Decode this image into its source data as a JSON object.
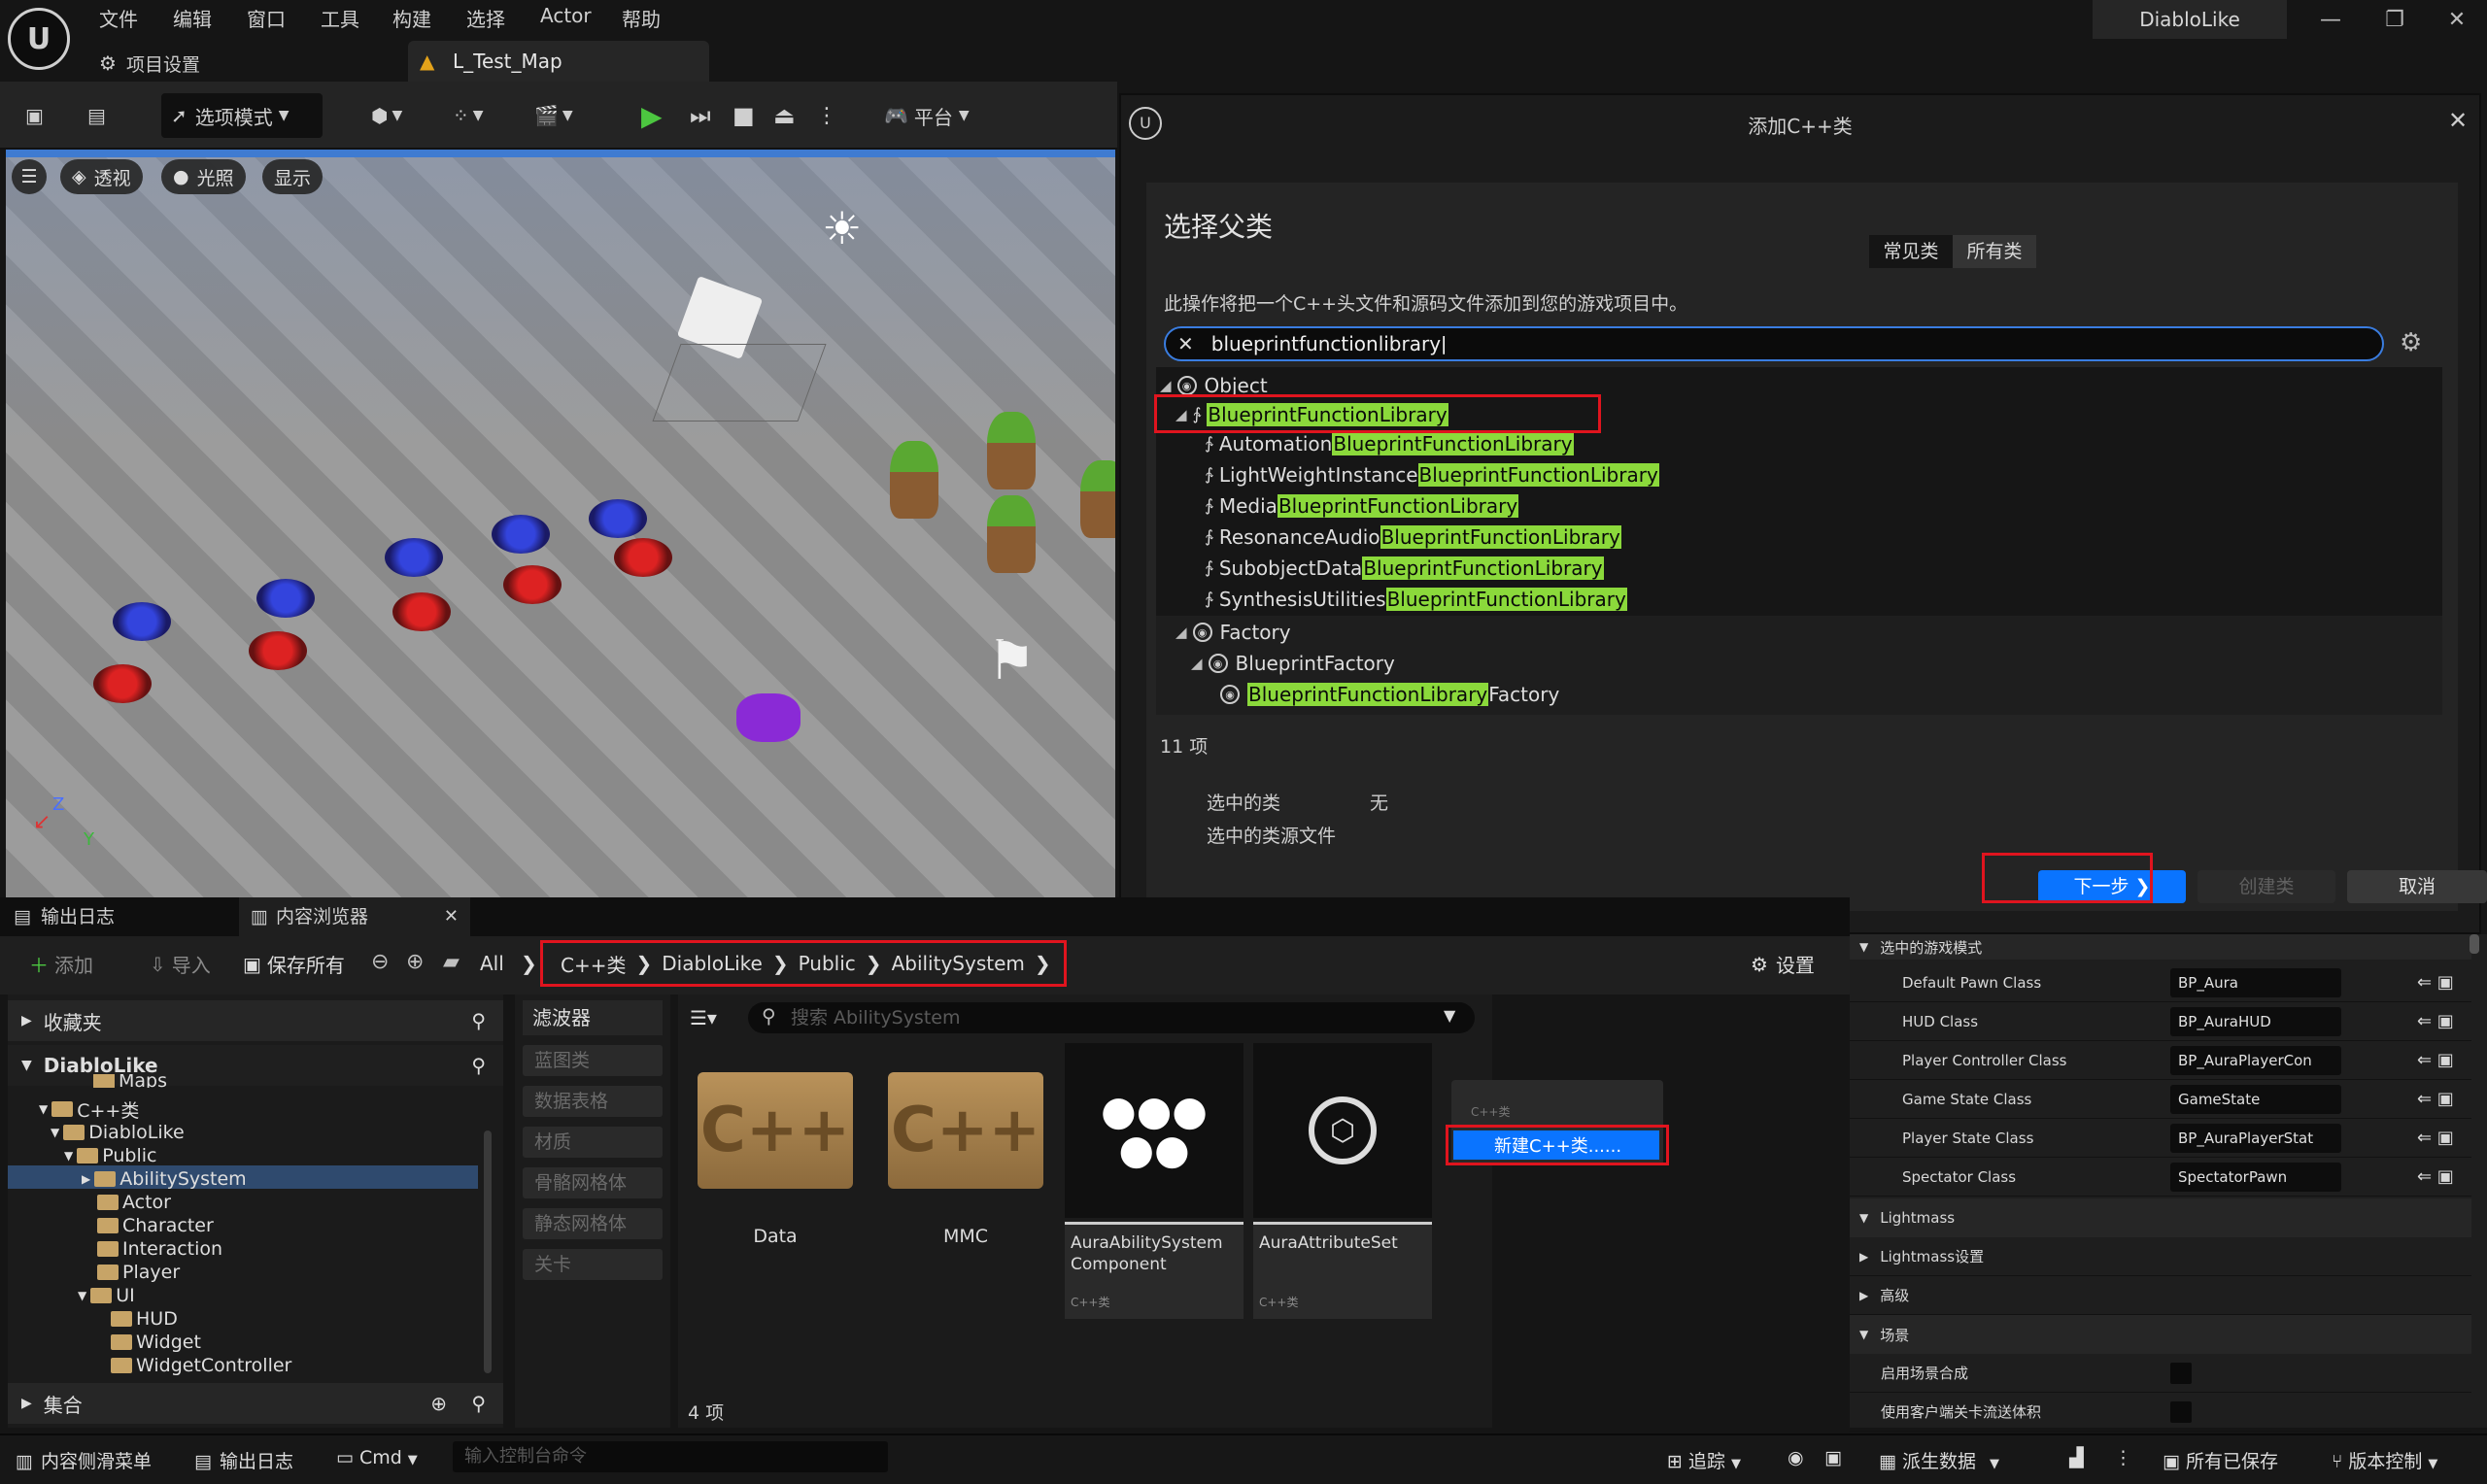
{
  "menu": {
    "items": [
      "文件",
      "编辑",
      "窗口",
      "工具",
      "构建",
      "选择",
      "Actor",
      "帮助"
    ]
  },
  "project_settings_tab": "项目设置",
  "map_tab": "L_Test_Map",
  "app_title": "DiabloLike",
  "toolbar": {
    "mode_label": "选项模式",
    "platform_label": "平台"
  },
  "viewport": {
    "perspective": "透视",
    "lighting": "光照",
    "show": "显示",
    "axis_z": "Z",
    "axis_y": "Y"
  },
  "dialog": {
    "title": "添加C++类",
    "heading": "选择父类",
    "tab_common": "常见类",
    "tab_all": "所有类",
    "description": "此操作将把一个C++头文件和源码文件添加到您的游戏项目中。",
    "search_value": "blueprintfunctionlibrary",
    "tree": {
      "object": "Object",
      "bfl": "BlueprintFunctionLibrary",
      "children": [
        {
          "prefix": "Automation",
          "match": "BlueprintFunctionLibrary"
        },
        {
          "prefix": "LightWeightInstance",
          "match": "BlueprintFunctionLibrary"
        },
        {
          "prefix": "Media",
          "match": "BlueprintFunctionLibrary"
        },
        {
          "prefix": "ResonanceAudio",
          "match": "BlueprintFunctionLibrary"
        },
        {
          "prefix": "SubobjectData",
          "match": "BlueprintFunctionLibrary"
        },
        {
          "prefix": "SynthesisUtilities",
          "match": "BlueprintFunctionLibrary"
        }
      ],
      "factory": "Factory",
      "blueprint_factory": "BlueprintFactory",
      "bfl_factory_match": "BlueprintFunctionLibrary",
      "bfl_factory_suffix": "Factory"
    },
    "item_count": "11 项",
    "selected_class_label": "选中的类",
    "selected_class_value": "无",
    "selected_source_label": "选中的类源文件",
    "btn_next": "下一步",
    "btn_create": "创建类",
    "btn_cancel": "取消"
  },
  "bottom_tabs": {
    "output_log": "输出日志",
    "content_browser": "内容浏览器"
  },
  "content_browser": {
    "add": "添加",
    "import": "导入",
    "save_all": "保存所有",
    "all": "All",
    "breadcrumb": [
      "C++类",
      "DiabloLike",
      "Public",
      "AbilitySystem"
    ],
    "settings": "设置",
    "favorites": "收藏夹",
    "project": "DiabloLike",
    "collections": "集合",
    "folders": [
      {
        "name": "Maps",
        "indent": 3
      },
      {
        "name": "C++类",
        "indent": 1
      },
      {
        "name": "DiabloLike",
        "indent": 2
      },
      {
        "name": "Public",
        "indent": 3
      },
      {
        "name": "AbilitySystem",
        "indent": 4
      },
      {
        "name": "Actor",
        "indent": 4
      },
      {
        "name": "Character",
        "indent": 4
      },
      {
        "name": "Interaction",
        "indent": 4
      },
      {
        "name": "Player",
        "indent": 4
      },
      {
        "name": "UI",
        "indent": 3
      },
      {
        "name": "HUD",
        "indent": 4
      },
      {
        "name": "Widget",
        "indent": 4
      },
      {
        "name": "WidgetController",
        "indent": 4
      }
    ],
    "filters_label": "滤波器",
    "filters": [
      "蓝图类",
      "数据表格",
      "材质",
      "骨骼网格体",
      "静态网格体",
      "关卡"
    ],
    "search_placeholder": "搜索 AbilitySystem",
    "assets": [
      {
        "name": "Data",
        "kind": "folder"
      },
      {
        "name": "MMC",
        "kind": "folder"
      },
      {
        "name": "AuraAbilitySystem Component",
        "type": "C++类"
      },
      {
        "name": "AuraAttributeSet",
        "type": "C++类"
      }
    ],
    "new_cpp_label": "新建C++类......",
    "new_cpp_header": "C++类",
    "item_count": "4 项"
  },
  "details": {
    "section_gamemode": "选中的游戏模式",
    "rows": [
      {
        "label": "Default Pawn Class",
        "value": "BP_Aura"
      },
      {
        "label": "HUD Class",
        "value": "BP_AuraHUD"
      },
      {
        "label": "Player Controller Class",
        "value": "BP_AuraPlayerCon"
      },
      {
        "label": "Game State Class",
        "value": "GameState"
      },
      {
        "label": "Player State Class",
        "value": "BP_AuraPlayerStat"
      },
      {
        "label": "Spectator Class",
        "value": "SpectatorPawn"
      }
    ],
    "lightmass": "Lightmass",
    "lightmass_settings": "Lightmass设置",
    "advanced": "高级",
    "scene": "场景",
    "scene_rows": [
      "启用场景合成",
      "使用客户端关卡流送体积"
    ]
  },
  "statusbar": {
    "drawer": "内容侧滑菜单",
    "output_log": "输出日志",
    "cmd": "Cmd",
    "console_placeholder": "输入控制台命令",
    "trace": "追踪",
    "derived_data": "派生数据",
    "all_saved": "所有已保存",
    "source_control": "版本控制"
  }
}
